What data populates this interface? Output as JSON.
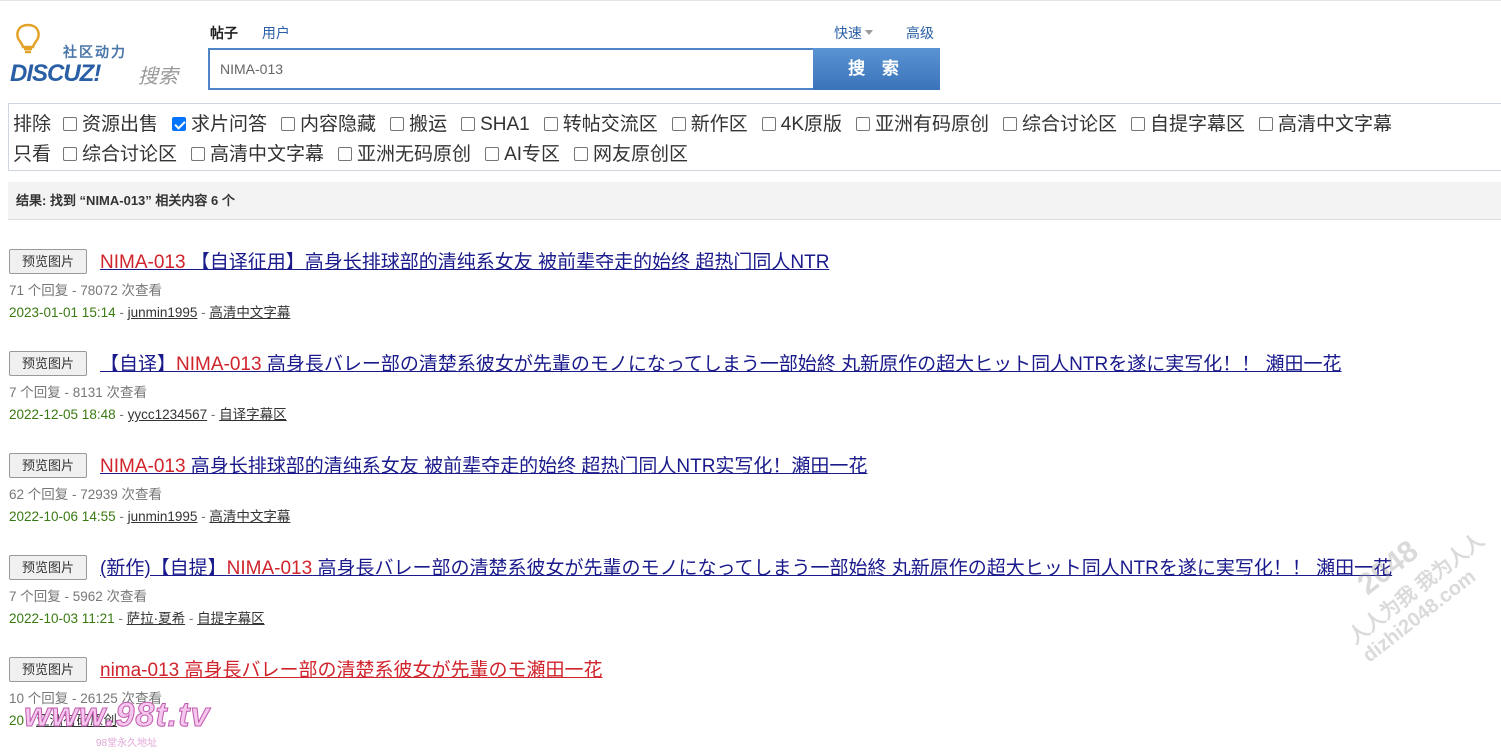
{
  "logo": {
    "small_text": "社区动力",
    "main_text": "DISCUZ!",
    "sub_text": "搜索"
  },
  "tabs": [
    {
      "label": "帖子",
      "active": true
    },
    {
      "label": "用户",
      "active": false
    }
  ],
  "quick_label": "快速",
  "advanced_label": "高级",
  "search": {
    "value": "NIMA-013",
    "button_label": "搜 索"
  },
  "filters": {
    "exclude_label": "排除",
    "row1": [
      {
        "label": "资源出售",
        "checked": false
      },
      {
        "label": "求片问答",
        "checked": true
      },
      {
        "label": "内容隐藏",
        "checked": false
      },
      {
        "label": "搬运",
        "checked": false
      },
      {
        "label": "SHA1",
        "checked": false
      },
      {
        "label": "转帖交流区",
        "checked": false
      },
      {
        "label": "新作区",
        "checked": false
      },
      {
        "label": "4K原版",
        "checked": false
      },
      {
        "label": "亚洲有码原创",
        "checked": false
      },
      {
        "label": "综合讨论区",
        "checked": false
      },
      {
        "label": "自提字幕区",
        "checked": false
      },
      {
        "label": "高清中文字幕",
        "checked": false
      }
    ],
    "only_label": "只看",
    "row2": [
      {
        "label": "综合讨论区",
        "checked": false
      },
      {
        "label": "高清中文字幕",
        "checked": false
      },
      {
        "label": "亚洲无码原创",
        "checked": false
      },
      {
        "label": "AI专区",
        "checked": false
      },
      {
        "label": "网友原创区",
        "checked": false
      }
    ]
  },
  "result_summary": "结果: 找到 “NIMA-013” 相关内容 6 个",
  "preview_label": "预览图片",
  "results": [
    {
      "title_pre": "",
      "title_hl": "NIMA-013",
      "title_post": " 【自译征用】高身长排球部的清纯系女友 被前辈夺走的始终 超热门同人NTR",
      "meta": "71 个回复 - 78072 次查看",
      "date": "2023-01-01 15:14",
      "author": "junmin1995",
      "forum": "高清中文字幕"
    },
    {
      "title_pre": "【自译】",
      "title_hl": "NIMA-013",
      "title_post": " 高身長バレー部の清楚系彼女が先輩のモノになってしまう一部始終 丸新原作の超大ヒット同人NTRを遂に実写化！！ 瀬田一花",
      "meta": "7 个回复 - 8131 次查看",
      "date": "2022-12-05 18:48",
      "author": "yycc1234567",
      "forum": "自译字幕区"
    },
    {
      "title_pre": "",
      "title_hl": "NIMA-013",
      "title_post": " 高身长排球部的清纯系女友 被前辈夺走的始终 超热门同人NTR实写化！瀬田一花",
      "meta": "62 个回复 - 72939 次查看",
      "date": "2022-10-06 14:55",
      "author": "junmin1995",
      "forum": "高清中文字幕"
    },
    {
      "title_pre": "(新作)【自提】",
      "title_hl": "NIMA-013",
      "title_post": " 高身長バレー部の清楚系彼女が先輩のモノになってしまう一部始終 丸新原作の超大ヒット同人NTRを遂に実写化！！ 瀬田一花",
      "meta": "7 个回复 - 5962 次查看",
      "date": "2022-10-03 11:21",
      "author": "萨拉·夏希",
      "forum": "自提字幕区"
    },
    {
      "title_pre": "",
      "title_hl": "nima-013",
      "title_post": " 高身長バレー部の清楚系彼女が先輩のモ瀬田一花",
      "meta": "10 个回复 - 26125 次查看",
      "date": "20",
      "author": "",
      "forum": "亚洲有码原创",
      "all_red": true
    }
  ],
  "watermarks": {
    "site_logo": "www.98t.tv",
    "site_logo_sub": "98堂永久地址",
    "stamp_big": "2048",
    "stamp_line1": "人人为我 我为人人",
    "stamp_line2": "dizhi2048.com"
  },
  "colors": {
    "link": "#1a1a8c",
    "highlight": "#d0232b",
    "date": "#3a7a12",
    "search_border": "#4d84c6"
  }
}
